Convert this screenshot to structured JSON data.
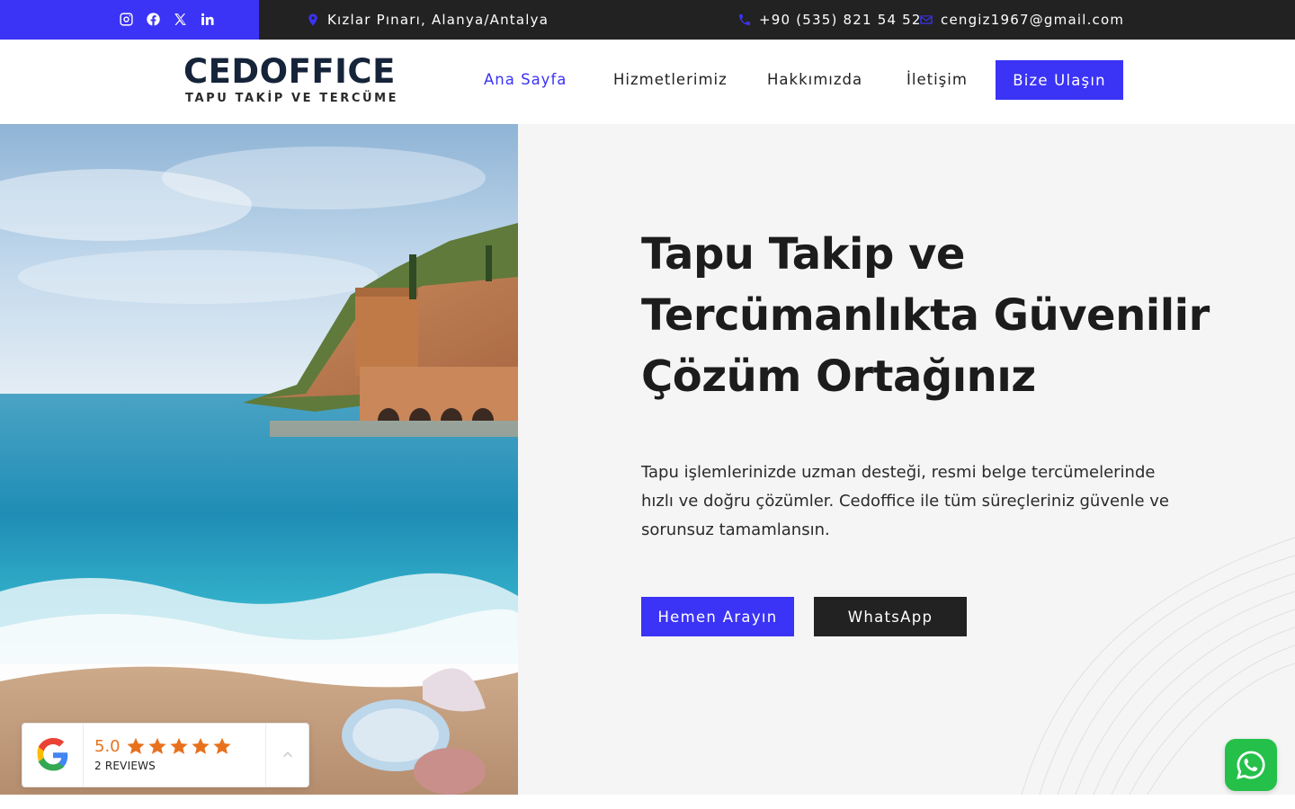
{
  "topbar": {
    "social": [
      {
        "icon": "instagram-icon"
      },
      {
        "icon": "facebook-icon"
      },
      {
        "icon": "x-twitter-icon"
      },
      {
        "icon": "linkedin-icon"
      }
    ],
    "address": "Kızlar Pınarı, Alanya/Antalya",
    "phone": "+90 (535) 821 54 52",
    "email": "cengiz1967@gmail.com"
  },
  "header": {
    "logo_main": "CEDOFFICE",
    "logo_sub": "TAPU TAKİP VE TERCÜME",
    "nav": {
      "home": "Ana Sayfa",
      "services": "Hizmetlerimiz",
      "about": "Hakkımızda",
      "contact": "İletişim"
    },
    "cta": "Bize Ulaşın"
  },
  "hero": {
    "title": "Tapu Takip ve Tercümanlıkta Güvenilir Çözüm Ortağınız",
    "text": "Tapu işlemlerinizde uzman desteği, resmi belge tercümelerinde hızlı ve doğru çözümler. Cedoffice ile tüm süreçleriniz güvenle ve sorunsuz tamamlansın.",
    "btn_call": "Hemen Arayın",
    "btn_whatsapp": "WhatsApp"
  },
  "reviews": {
    "score": "5.0",
    "stars": 5,
    "count": "2 REVIEWS"
  },
  "colors": {
    "accent": "#3b33f5",
    "dark": "#222222",
    "logo": "#16243a",
    "star": "#e8711d",
    "whatsapp": "#25c04a"
  }
}
